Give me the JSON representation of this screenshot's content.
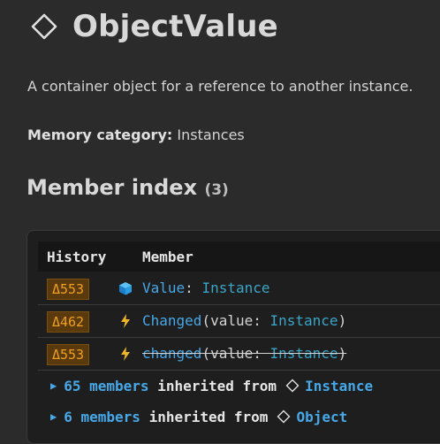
{
  "page": {
    "title": "ObjectValue",
    "description": "A container object for a reference to another instance.",
    "memory_label": "Memory category:",
    "memory_value": "Instances",
    "member_index_label": "Member index",
    "member_count": "(3)"
  },
  "table": {
    "col_history": "History",
    "col_member": "Member",
    "rows": [
      {
        "history": "Δ553",
        "icon": "property-cube-icon",
        "name": "Value",
        "sep": ": ",
        "type": "Instance"
      },
      {
        "history": "Δ462",
        "icon": "event-lightning-icon",
        "name": "Changed",
        "open": "(value: ",
        "type": "Instance",
        "close": ")"
      },
      {
        "history": "Δ553",
        "icon": "event-lightning-icon",
        "name": "changed",
        "open": "(value: ",
        "type": "Instance",
        "close": ")",
        "deprecated": true
      }
    ]
  },
  "inherited": [
    {
      "count": "65 members",
      "text": "inherited from",
      "class": "Instance"
    },
    {
      "count": "6 members",
      "text": "inherited from",
      "class": "Object"
    }
  ],
  "colors": {
    "background": "#2b2b2b",
    "panel": "#1e1e1e",
    "link_blue": "#47a8e8",
    "badge_bg": "#5a3a0c",
    "badge_text": "#f0a020",
    "lightning": "#f0b428"
  }
}
